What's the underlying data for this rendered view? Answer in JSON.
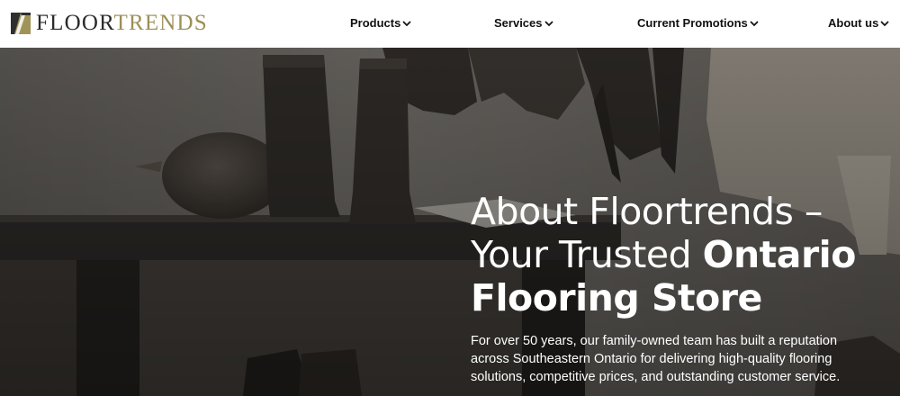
{
  "brand": {
    "name_part_a": "FLOOR",
    "name_part_b": "TRENDS",
    "icon": "floortrends-logo-icon",
    "colors": {
      "dark": "#2b2b2b",
      "gold": "#9c8f57"
    }
  },
  "nav": {
    "items": [
      {
        "label": "Products",
        "icon": "chevron-down-icon"
      },
      {
        "label": "Services",
        "icon": "chevron-down-icon"
      },
      {
        "label": "Current Promotions",
        "icon": "chevron-down-icon"
      },
      {
        "label": "About us",
        "icon": "chevron-down-icon"
      }
    ]
  },
  "hero": {
    "title_light": "About Floortrends – Your Trusted ",
    "title_bold": "Ontario Flooring Store",
    "body": "For over 50 years, our family-owned team has built a reputation across Southeastern Ontario for delivering high-quality flooring solutions, competitive prices, and outstanding customer service."
  }
}
